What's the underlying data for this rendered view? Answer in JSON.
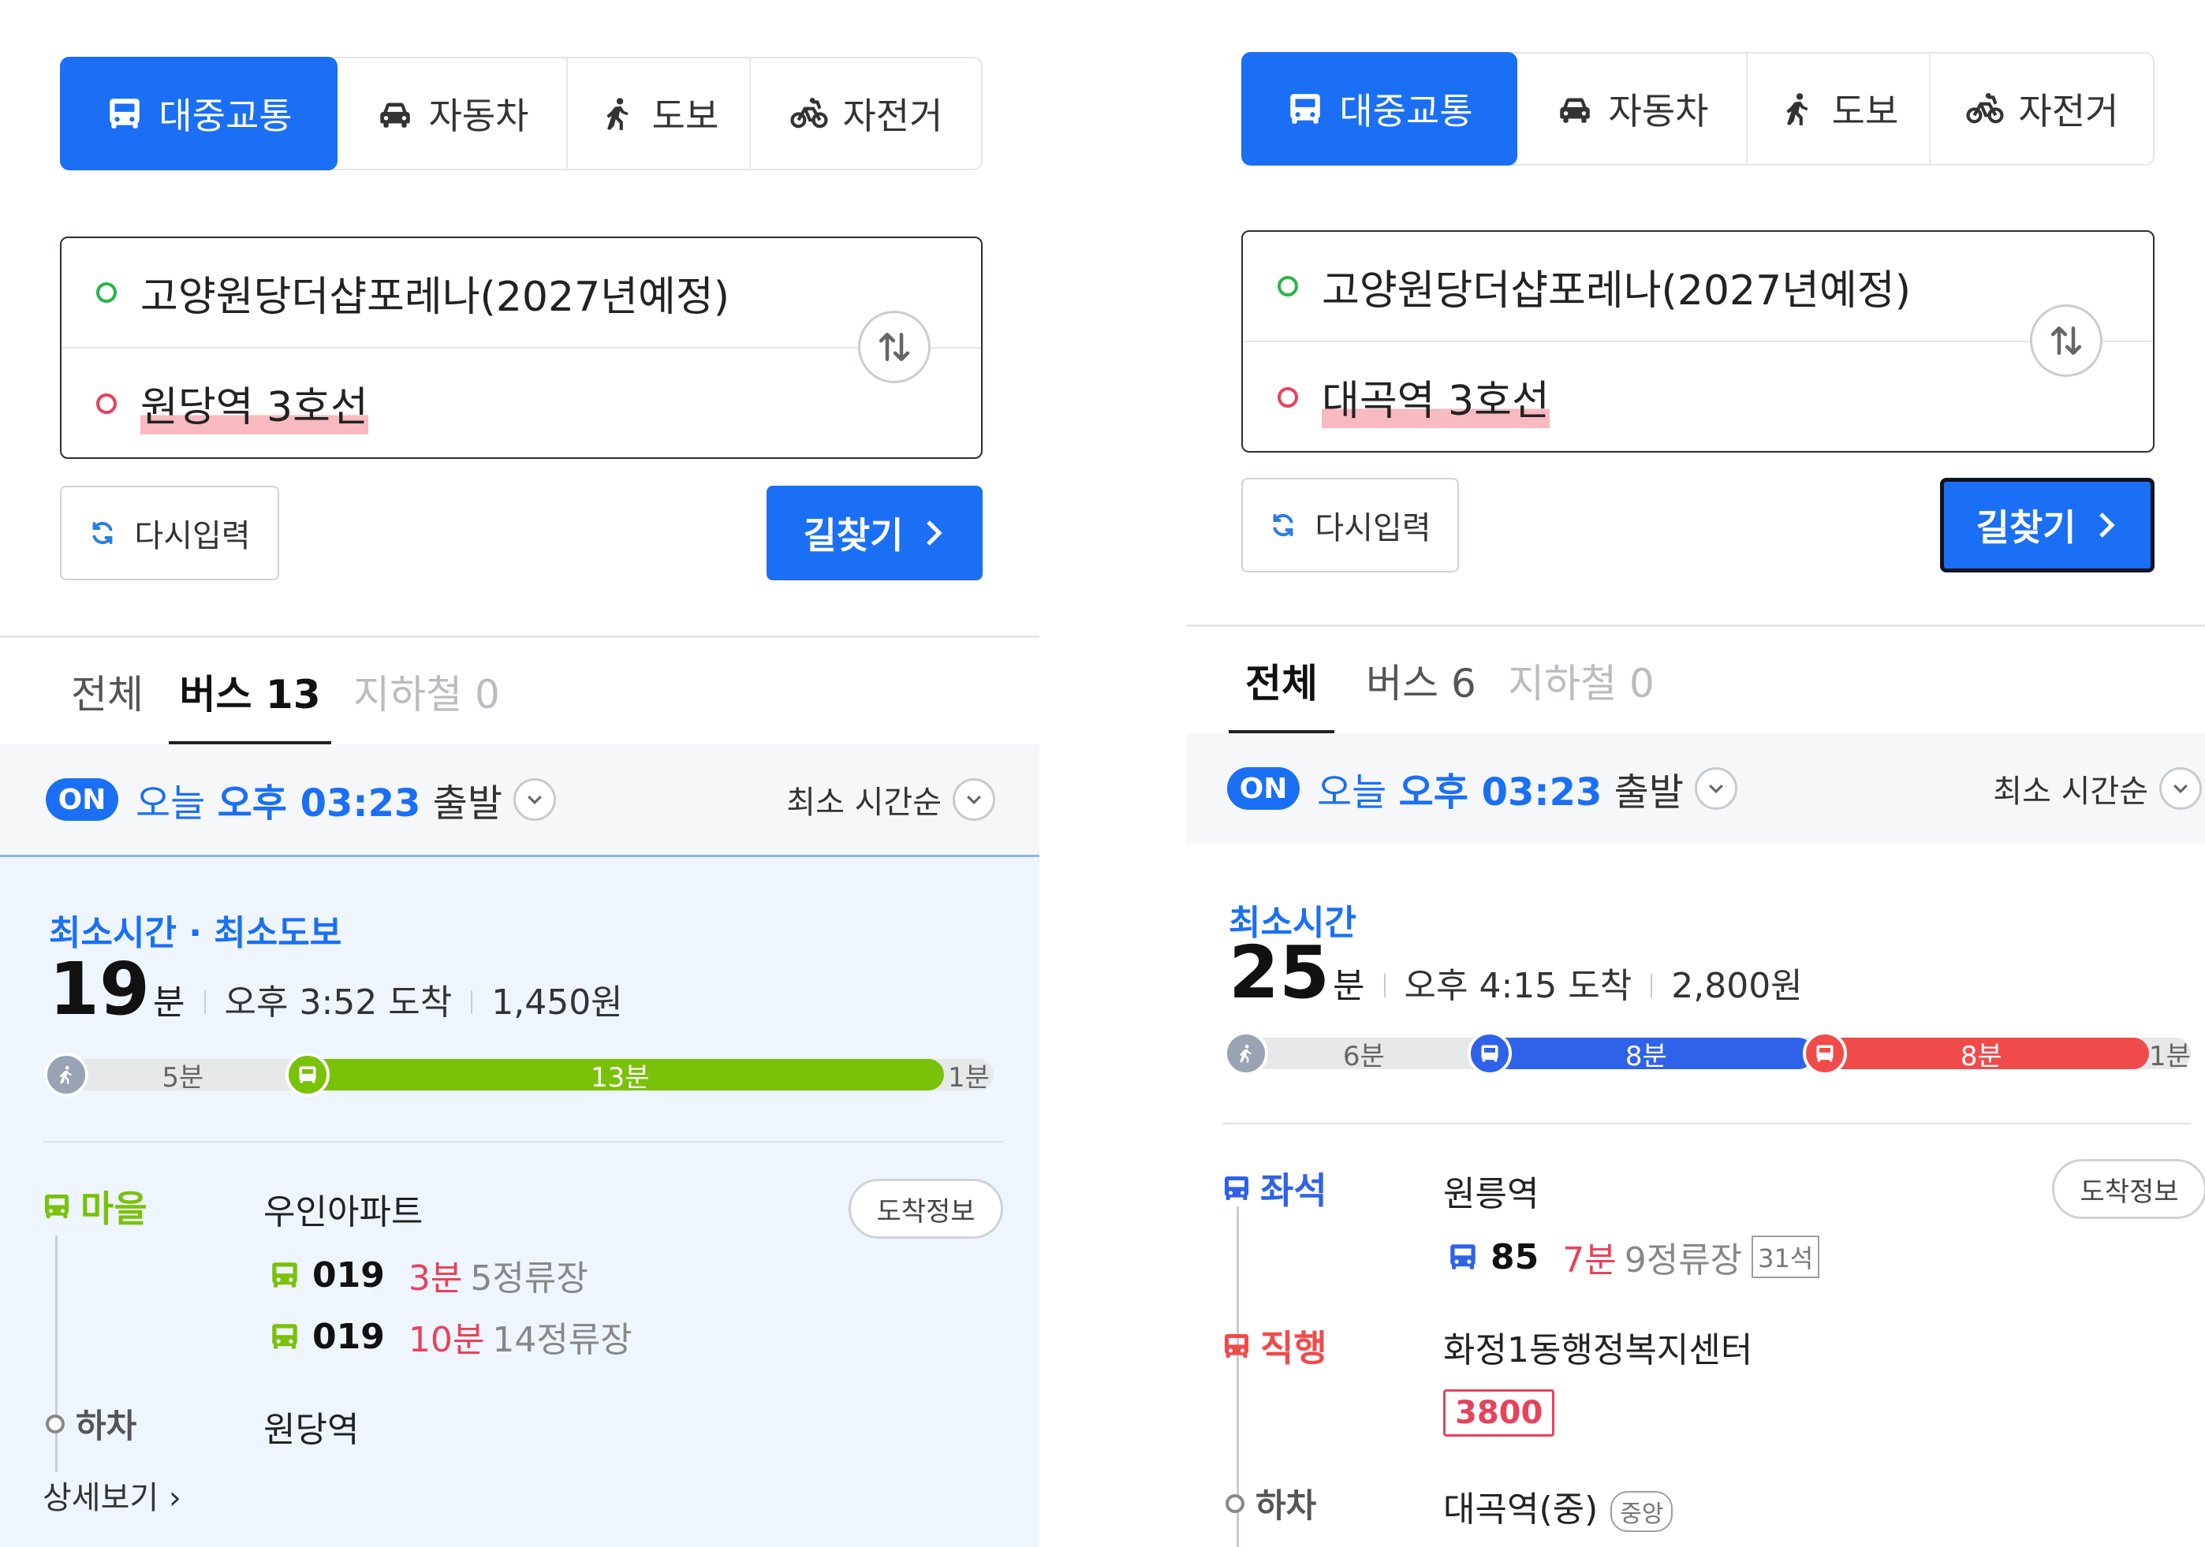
{
  "colors": {
    "primary": "#1a6ff5",
    "village_bus": "#7ac10a",
    "seat_bus": "#2f62e8",
    "express_bus": "#f04b4b",
    "walk": "#9aa3b3",
    "eta": "#e8425a"
  },
  "left": {
    "modes": [
      {
        "label": "대중교통",
        "icon": "bus-icon"
      },
      {
        "label": "자동차",
        "icon": "car-icon"
      },
      {
        "label": "도보",
        "icon": "walk-icon"
      },
      {
        "label": "자전거",
        "icon": "bike-icon"
      }
    ],
    "origin": "고양원당더샵포레나(2027년예정)",
    "destination": "원당역 3호선",
    "reset_label": "다시입력",
    "search_label": "길찾기",
    "tabs": [
      {
        "label": "전체"
      },
      {
        "label": "버스 13"
      },
      {
        "label": "지하철 0"
      }
    ],
    "depart": {
      "on": "ON",
      "prefix": "오늘 ",
      "time": "오후 03:23",
      "suffix": " 출발"
    },
    "sort_label": "최소 시간순",
    "result": {
      "badge": "최소시간 · 최소도보",
      "minutes": "19",
      "unit": "분",
      "arrival": "오후 3:52 도착",
      "fare": "1,450원",
      "segments": [
        {
          "type": "walk",
          "label": "5분",
          "minutes": 5
        },
        {
          "type": "village",
          "label": "13분",
          "minutes": 13
        },
        {
          "type": "walk",
          "label": "1분",
          "minutes": 1
        }
      ],
      "step": {
        "type_label": "마을",
        "station": "우인아파트",
        "arrival_btn": "도착정보",
        "buses": [
          {
            "no": "019",
            "eta": "3분",
            "stops": "5정류장"
          },
          {
            "no": "019",
            "eta": "10분",
            "stops": "14정류장"
          }
        ]
      },
      "alight_label": "하차",
      "alight_station": "원당역",
      "detail_label": "상세보기"
    }
  },
  "right": {
    "modes": [
      {
        "label": "대중교통",
        "icon": "bus-icon"
      },
      {
        "label": "자동차",
        "icon": "car-icon"
      },
      {
        "label": "도보",
        "icon": "walk-icon"
      },
      {
        "label": "자전거",
        "icon": "bike-icon"
      }
    ],
    "origin": "고양원당더샵포레나(2027년예정)",
    "destination": "대곡역 3호선",
    "reset_label": "다시입력",
    "search_label": "길찾기",
    "tabs": [
      {
        "label": "전체"
      },
      {
        "label": "버스 6"
      },
      {
        "label": "지하철 0"
      }
    ],
    "depart": {
      "on": "ON",
      "prefix": "오늘 ",
      "time": "오후 03:23",
      "suffix": " 출발"
    },
    "sort_label": "최소 시간순",
    "result": {
      "badge": "최소시간",
      "minutes": "25",
      "unit": "분",
      "arrival": "오후 4:15 도착",
      "fare": "2,800원",
      "segments": [
        {
          "type": "walk",
          "label": "6분",
          "minutes": 6
        },
        {
          "type": "seat",
          "label": "8분",
          "minutes": 8
        },
        {
          "type": "express",
          "label": "8분",
          "minutes": 8
        },
        {
          "type": "walk",
          "label": "1분",
          "minutes": 1
        }
      ],
      "step1": {
        "type_label": "좌석",
        "station": "원릉역",
        "arrival_btn": "도착정보",
        "bus": {
          "no": "85",
          "eta": "7분",
          "stops": "9정류장",
          "seats": "31석"
        }
      },
      "step2": {
        "type_label": "직행",
        "station": "화정1동행정복지센터",
        "route_no": "3800"
      },
      "alight_label": "하차",
      "alight_station": "대곡역(중)",
      "alight_tag": "중앙"
    }
  }
}
